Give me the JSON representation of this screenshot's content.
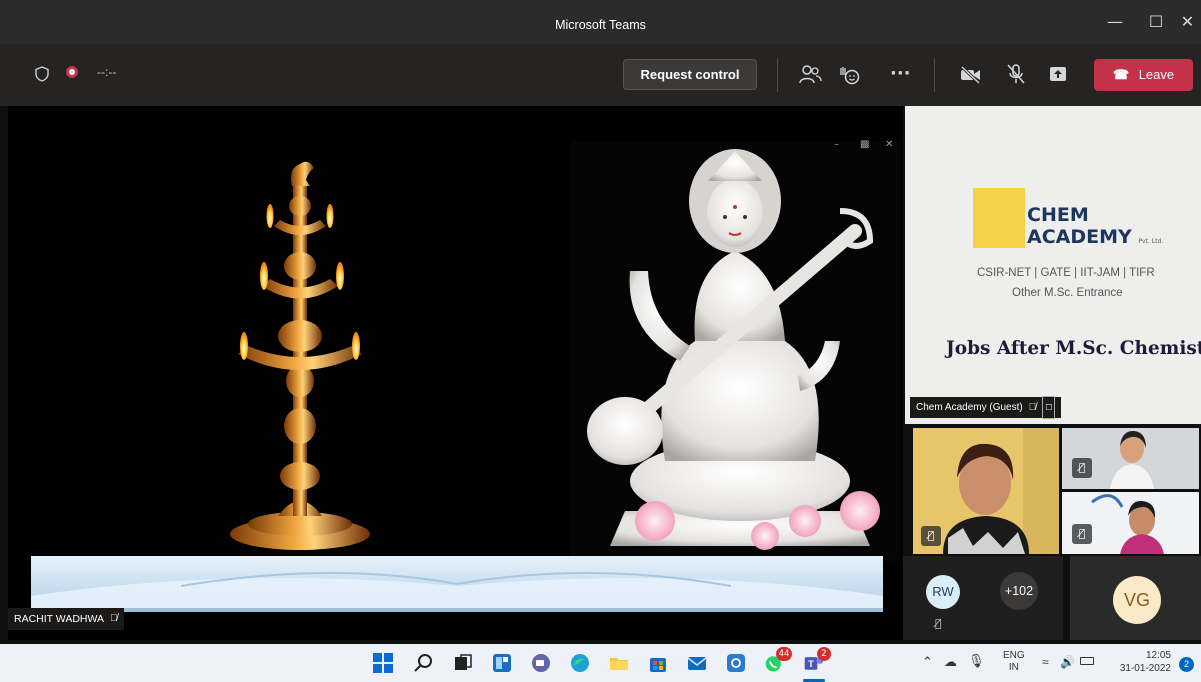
{
  "window": {
    "title": "Microsoft Teams"
  },
  "toolbar": {
    "timer": "--:--",
    "request_control_label": "Request control",
    "leave_label": "Leave"
  },
  "stage": {
    "presenter_name": "RACHIT WADHWA"
  },
  "slide": {
    "brand_line1": "CHEM",
    "brand_line2": "ACADEMY",
    "brand_suffix": "Pvt. Ltd.",
    "exams": "CSIR-NET | GATE | IIT-JAM | TIFR",
    "exams2": "Other M.Sc. Entrance",
    "headline": "Jobs After M.Sc. Chemistry",
    "participant_label": "Chem Academy (Guest)"
  },
  "participants": {
    "rw_initials": "RW",
    "overflow_count": "+102",
    "vg_initials": "VG"
  },
  "taskbar": {
    "whatsapp_badge": "44",
    "teams_badge": "2",
    "lang_line1": "ENG",
    "lang_line2": "IN",
    "time": "12:05",
    "date": "31-01-2022",
    "notification_count": "2"
  },
  "colors": {
    "leave": "#c4314b",
    "accent_taskbar": "#0067c0"
  }
}
